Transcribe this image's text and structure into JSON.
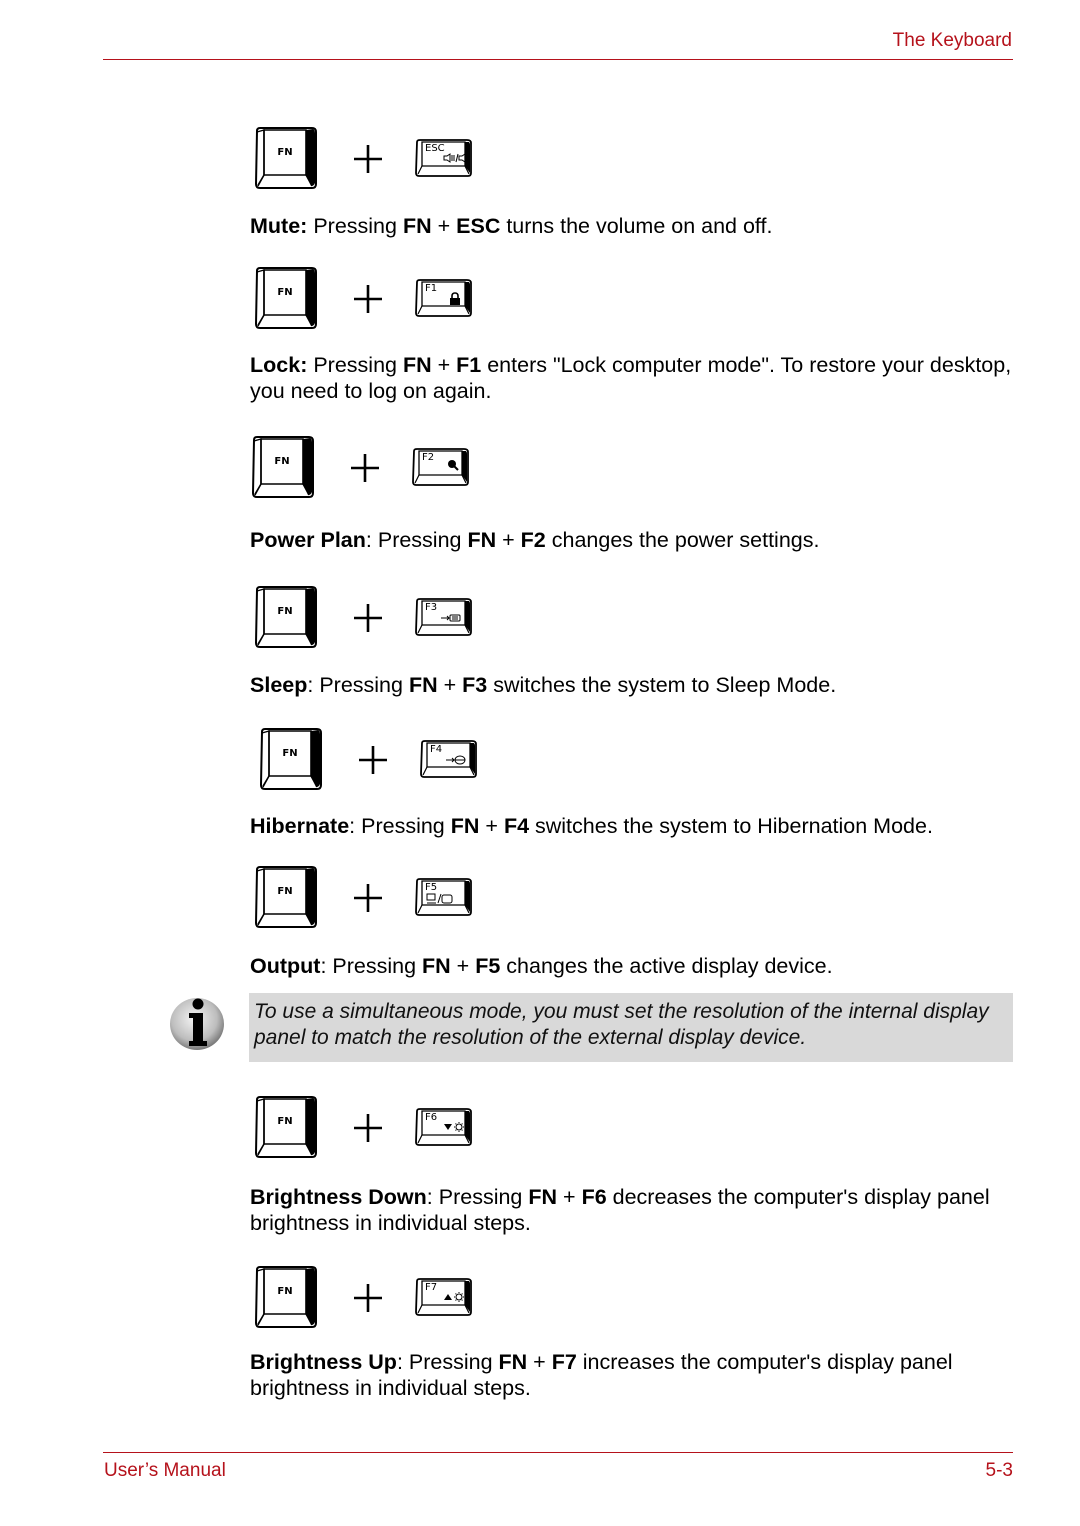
{
  "header": {
    "section_title": "The Keyboard"
  },
  "footer": {
    "manual_label": "User’s Manual",
    "page_number": "5-3"
  },
  "colors": {
    "accent": "#b5121b",
    "note_background": "#d9d9d9"
  },
  "plus_symbol": "+",
  "hotkeys": [
    {
      "fn_key": "FN",
      "key": "ESC",
      "key_icon": "speaker-mute-icon",
      "key_glyph": "⫷‖/⫷",
      "name": "Mute",
      "name_sep": ":",
      "pre": " Pressing ",
      "fn": "FN",
      "plus": " + ",
      "combo": "ESC",
      "post": " turns the volume on and off."
    },
    {
      "fn_key": "FN",
      "key": "F1",
      "key_icon": "lock-icon",
      "key_glyph": "",
      "name": "Lock",
      "name_sep": ":",
      "pre": " Pressing ",
      "fn": "FN",
      "plus": " + ",
      "combo": "F1",
      "post": " enters \"Lock computer mode\". To restore your desktop, you need to log on again."
    },
    {
      "fn_key": "FN",
      "key": "F2",
      "key_icon": "power-plan-icon",
      "key_glyph": "",
      "name": "Power Plan",
      "name_sep": "",
      "pre": ": Pressing ",
      "fn": "FN",
      "plus": " + ",
      "combo": "F2",
      "post": " changes the power settings."
    },
    {
      "fn_key": "FN",
      "key": "F3",
      "key_icon": "sleep-icon",
      "key_glyph": "",
      "name": "Sleep",
      "name_sep": "",
      "pre": ": Pressing ",
      "fn": "FN",
      "plus": " + ",
      "combo": "F3",
      "post": " switches the system to Sleep Mode."
    },
    {
      "fn_key": "FN",
      "key": "F4",
      "key_icon": "hibernate-icon",
      "key_glyph": "",
      "name": "Hibernate",
      "name_sep": "",
      "pre": ": Pressing ",
      "fn": "FN",
      "plus": " + ",
      "combo": "F4",
      "post": " switches the system to Hibernation Mode."
    },
    {
      "fn_key": "FN",
      "key": "F5",
      "key_icon": "display-output-icon",
      "key_glyph": "",
      "name": "Output",
      "name_sep": "",
      "pre": ": Pressing ",
      "fn": "FN",
      "plus": " + ",
      "combo": "F5",
      "post": " changes the active display device."
    },
    {
      "fn_key": "FN",
      "key": "F6",
      "key_icon": "brightness-down-icon",
      "key_glyph": "▼☼",
      "name": "Brightness Down",
      "name_sep": "",
      "pre": ": Pressing ",
      "fn": "FN",
      "plus": " + ",
      "combo": "F6",
      "post": " decreases the computer's display panel brightness in individual steps."
    },
    {
      "fn_key": "FN",
      "key": "F7",
      "key_icon": "brightness-up-icon",
      "key_glyph": "▲☼",
      "name": "Brightness Up",
      "name_sep": "",
      "pre": ": Pressing ",
      "fn": "FN",
      "plus": " + ",
      "combo": "F7",
      "post": " increases the computer's display panel brightness in individual steps."
    }
  ],
  "note": {
    "icon": "info-icon",
    "text": "To use a simultaneous mode, you must set the resolution of the internal display panel to match the resolution of the external display device."
  }
}
